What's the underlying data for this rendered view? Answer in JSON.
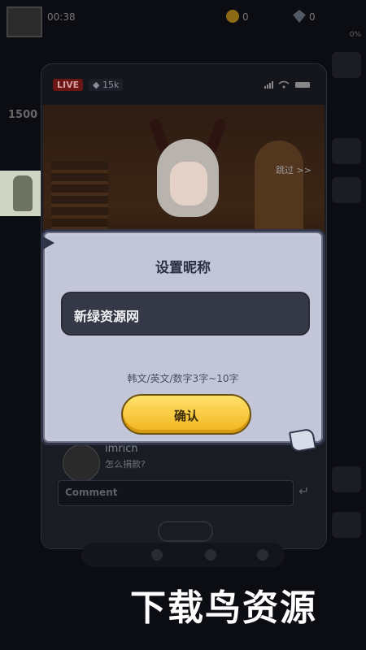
{
  "hud": {
    "timer": "00:38",
    "coins": "0",
    "gems": "0",
    "percent": "0%",
    "left_gems": "1500"
  },
  "stream": {
    "live_label": "LIVE",
    "views": "15k",
    "skip_label": "跳过 >>",
    "chat_name": "imrich",
    "chat_message": "怎么捐款?",
    "comment_placeholder": "Comment",
    "send_icon": "↵"
  },
  "dialog": {
    "title": "设置昵称",
    "nickname_value": "新绿资源网",
    "hint": "韩文/英文/数字3字~10字",
    "confirm_label": "确认"
  },
  "watermark": "下载鸟资源",
  "colors": {
    "confirm_button": "#f2b31d",
    "dialog_bg": "#c8cbdd",
    "field_bg": "#353846",
    "live_badge": "#6b1515"
  },
  "icons": {
    "signal": "signal-icon",
    "wifi": "wifi-icon",
    "battery": "battery-icon",
    "eye": "eye-icon",
    "coin": "coin-icon",
    "gem": "gem-icon",
    "send": "send-icon"
  }
}
